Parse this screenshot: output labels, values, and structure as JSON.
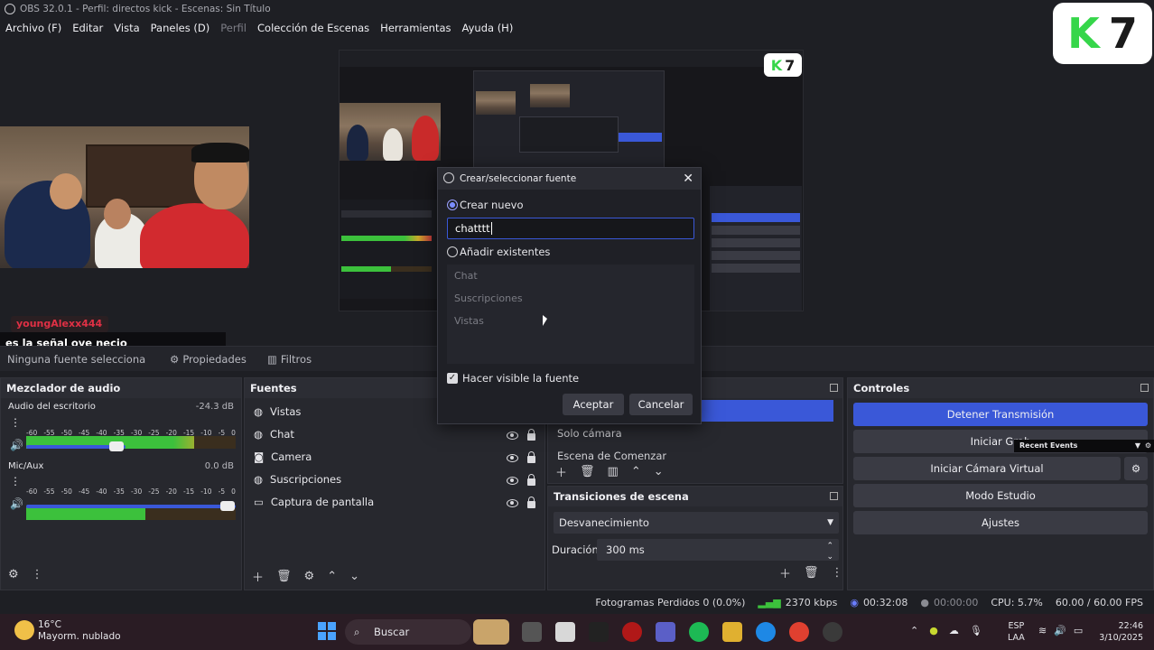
{
  "window": {
    "title": "OBS 32.0.1 - Perfil: directos kick - Escenas: Sin Título"
  },
  "menu": [
    {
      "label": "Archivo (F)",
      "enabled": true
    },
    {
      "label": "Editar",
      "enabled": true
    },
    {
      "label": "Vista",
      "enabled": true
    },
    {
      "label": "Paneles (D)",
      "enabled": true
    },
    {
      "label": "Perfil",
      "enabled": false
    },
    {
      "label": "Colección de Escenas",
      "enabled": true
    },
    {
      "label": "Herramientas",
      "enabled": true
    },
    {
      "label": "Ayuda (H)",
      "enabled": true
    }
  ],
  "logo": {
    "k": "K",
    "num": "7"
  },
  "overlay_chat": {
    "username": "youngAlexx444",
    "message": "es la señal oye necio"
  },
  "source_bar": {
    "no_selection": "Ninguna fuente selecciona",
    "properties": "Propiedades",
    "filters": "Filtros"
  },
  "audio_mixer": {
    "title": "Mezclador de audio",
    "channels": [
      {
        "name": "Audio del escritorio",
        "db": "-24.3 dB",
        "level": 0.8
      },
      {
        "name": "Mic/Aux",
        "db": "0.0 dB",
        "level": 0.57
      }
    ],
    "ticks": [
      "-60",
      "-55",
      "-50",
      "-45",
      "-40",
      "-35",
      "-30",
      "-25",
      "-20",
      "-15",
      "-10",
      "-5",
      "0"
    ]
  },
  "sources": {
    "title": "Fuentes",
    "items": [
      {
        "name": "Vistas",
        "icon": "globe-icon"
      },
      {
        "name": "Chat",
        "icon": "globe-icon"
      },
      {
        "name": "Camera",
        "icon": "camera-icon"
      },
      {
        "name": "Suscripciones",
        "icon": "globe-icon"
      },
      {
        "name": "Captura de pantalla",
        "icon": "monitor-icon"
      }
    ]
  },
  "scenes": {
    "items": [
      "Solo cámara",
      "Escena de Comenzar"
    ]
  },
  "transitions": {
    "title": "Transiciones de escena",
    "selected": "Desvanecimiento",
    "duration_label": "Duración",
    "duration_value": "300 ms"
  },
  "controls": {
    "title": "Controles",
    "stop_stream": "Detener Transmisión",
    "start_recording": "Iniciar Grab",
    "virtual_cam": "Iniciar Cámara Virtual",
    "studio_mode": "Modo Estudio",
    "settings": "Ajustes",
    "recent_events": "Recent Events"
  },
  "dialog": {
    "title": "Crear/seleccionar fuente",
    "create_new": "Crear nuevo",
    "input_value": "chatttt",
    "add_existing": "Añadir existentes",
    "existing": [
      "Chat",
      "Suscripciones",
      "Vistas"
    ],
    "make_visible": "Hacer visible la fuente",
    "accept": "Aceptar",
    "cancel": "Cancelar"
  },
  "status": {
    "dropped": "Fotogramas Perdidos 0 (0.0%)",
    "bitrate": "2370 kbps",
    "live_time": "00:32:08",
    "rec_time": "00:00:00",
    "cpu": "CPU: 5.7%",
    "fps": "60.00 / 60.00 FPS"
  },
  "taskbar": {
    "weather_temp": "16°C",
    "weather_desc": "Mayorm. nublado",
    "search": "Buscar",
    "lang_top": "ESP",
    "lang_bottom": "LAA",
    "time": "22:46",
    "date": "3/10/2025"
  },
  "colors": {
    "accent": "#3a58d8",
    "meter_green": "#3cc13c",
    "meter_yellow": "#c9a92a",
    "meter_red": "#c33a3a",
    "brand_green": "#36d64a"
  }
}
